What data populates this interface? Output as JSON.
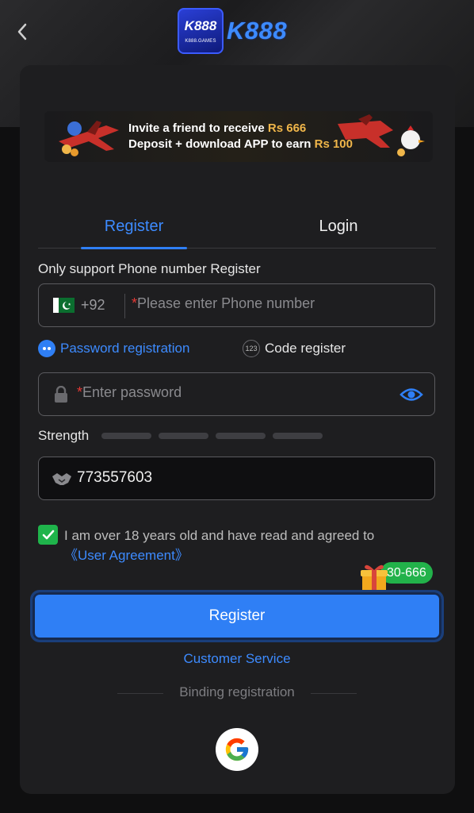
{
  "header": {
    "logo_badge_main": "K888",
    "logo_badge_sub": "K888.GAMES",
    "logo_text": "K888"
  },
  "banner": {
    "line1_prefix": "Invite a friend to receive",
    "line1_amount": "Rs 666",
    "line2_prefix": "Deposit + download APP to earn",
    "line2_amount": "Rs 100"
  },
  "tabs": [
    {
      "label": "Register",
      "active": true
    },
    {
      "label": "Login",
      "active": false
    }
  ],
  "form": {
    "hint": "Only support Phone number Register",
    "country_code": "+92",
    "phone_placeholder": "Please enter Phone number",
    "required_mark": "*",
    "option_password": "Password registration",
    "option_code": "Code register",
    "option_code_icon": "123",
    "password_placeholder": "Enter password",
    "strength_label": "Strength",
    "strength_level": 0,
    "referral_value": "773557603"
  },
  "agreement": {
    "checked": true,
    "text": "I am over 18 years old and have read and agreed to",
    "link": "《User Agreement》"
  },
  "promo_badge": "30-666",
  "register_button": "Register",
  "customer_service": "Customer Service",
  "binding_label": "Binding registration",
  "colors": {
    "accent": "#2f7ff5",
    "success": "#1fb44b",
    "gold": "#f0b64a",
    "background": "#0f0f10",
    "card": "#1e1e20"
  },
  "icons": [
    "back-arrow-icon",
    "pakistan-flag-icon",
    "lock-icon",
    "eye-icon",
    "handshake-icon",
    "checkmark-icon",
    "gift-icon",
    "google-icon"
  ]
}
